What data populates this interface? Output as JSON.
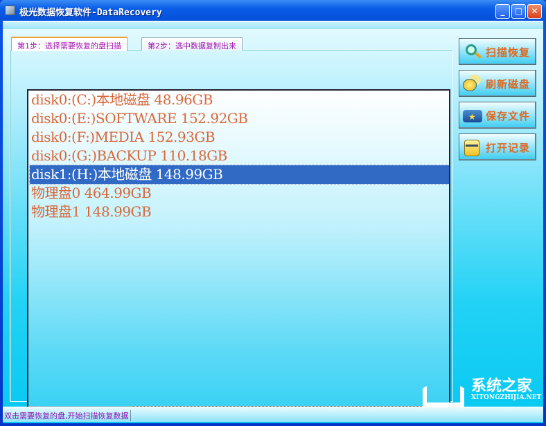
{
  "window": {
    "title": "极光数据恢复软件-DataRecovery",
    "minimize": "_",
    "maximize": "□",
    "close": "✕"
  },
  "tabs": [
    {
      "label": "第1步：选择需要恢复的盘扫描",
      "active": true
    },
    {
      "label": "第2步：选中数据复制出来",
      "active": false
    }
  ],
  "disks": [
    {
      "label": "disk0:(C:)本地磁盘 48.96GB"
    },
    {
      "label": "disk0:(E:)SOFTWARE 152.92GB"
    },
    {
      "label": "disk0:(F:)MEDIA 152.93GB"
    },
    {
      "label": "disk0:(G:)BACKUP 110.18GB"
    },
    {
      "label": "disk1:(H:)本地磁盘 148.99GB",
      "selected": true
    },
    {
      "label": "物理盘0 464.99GB"
    },
    {
      "label": "物理盘1 148.99GB"
    }
  ],
  "buttons": [
    {
      "label": "扫描恢复",
      "icon": "magnifier-icon"
    },
    {
      "label": "刷新磁盘",
      "icon": "refresh-disk-icon"
    },
    {
      "label": "保存文件",
      "icon": "save-folder-icon"
    },
    {
      "label": "打开记录",
      "icon": "open-record-icon"
    }
  ],
  "status": "双击需要恢复的盘,开始扫描恢复数据",
  "watermark": {
    "name": "系统之家",
    "url": "XITONGZHIJIA.NET"
  },
  "colors": {
    "item_text": "#d8683a",
    "selection": "#316ac5",
    "status_text": "#9010b0"
  }
}
